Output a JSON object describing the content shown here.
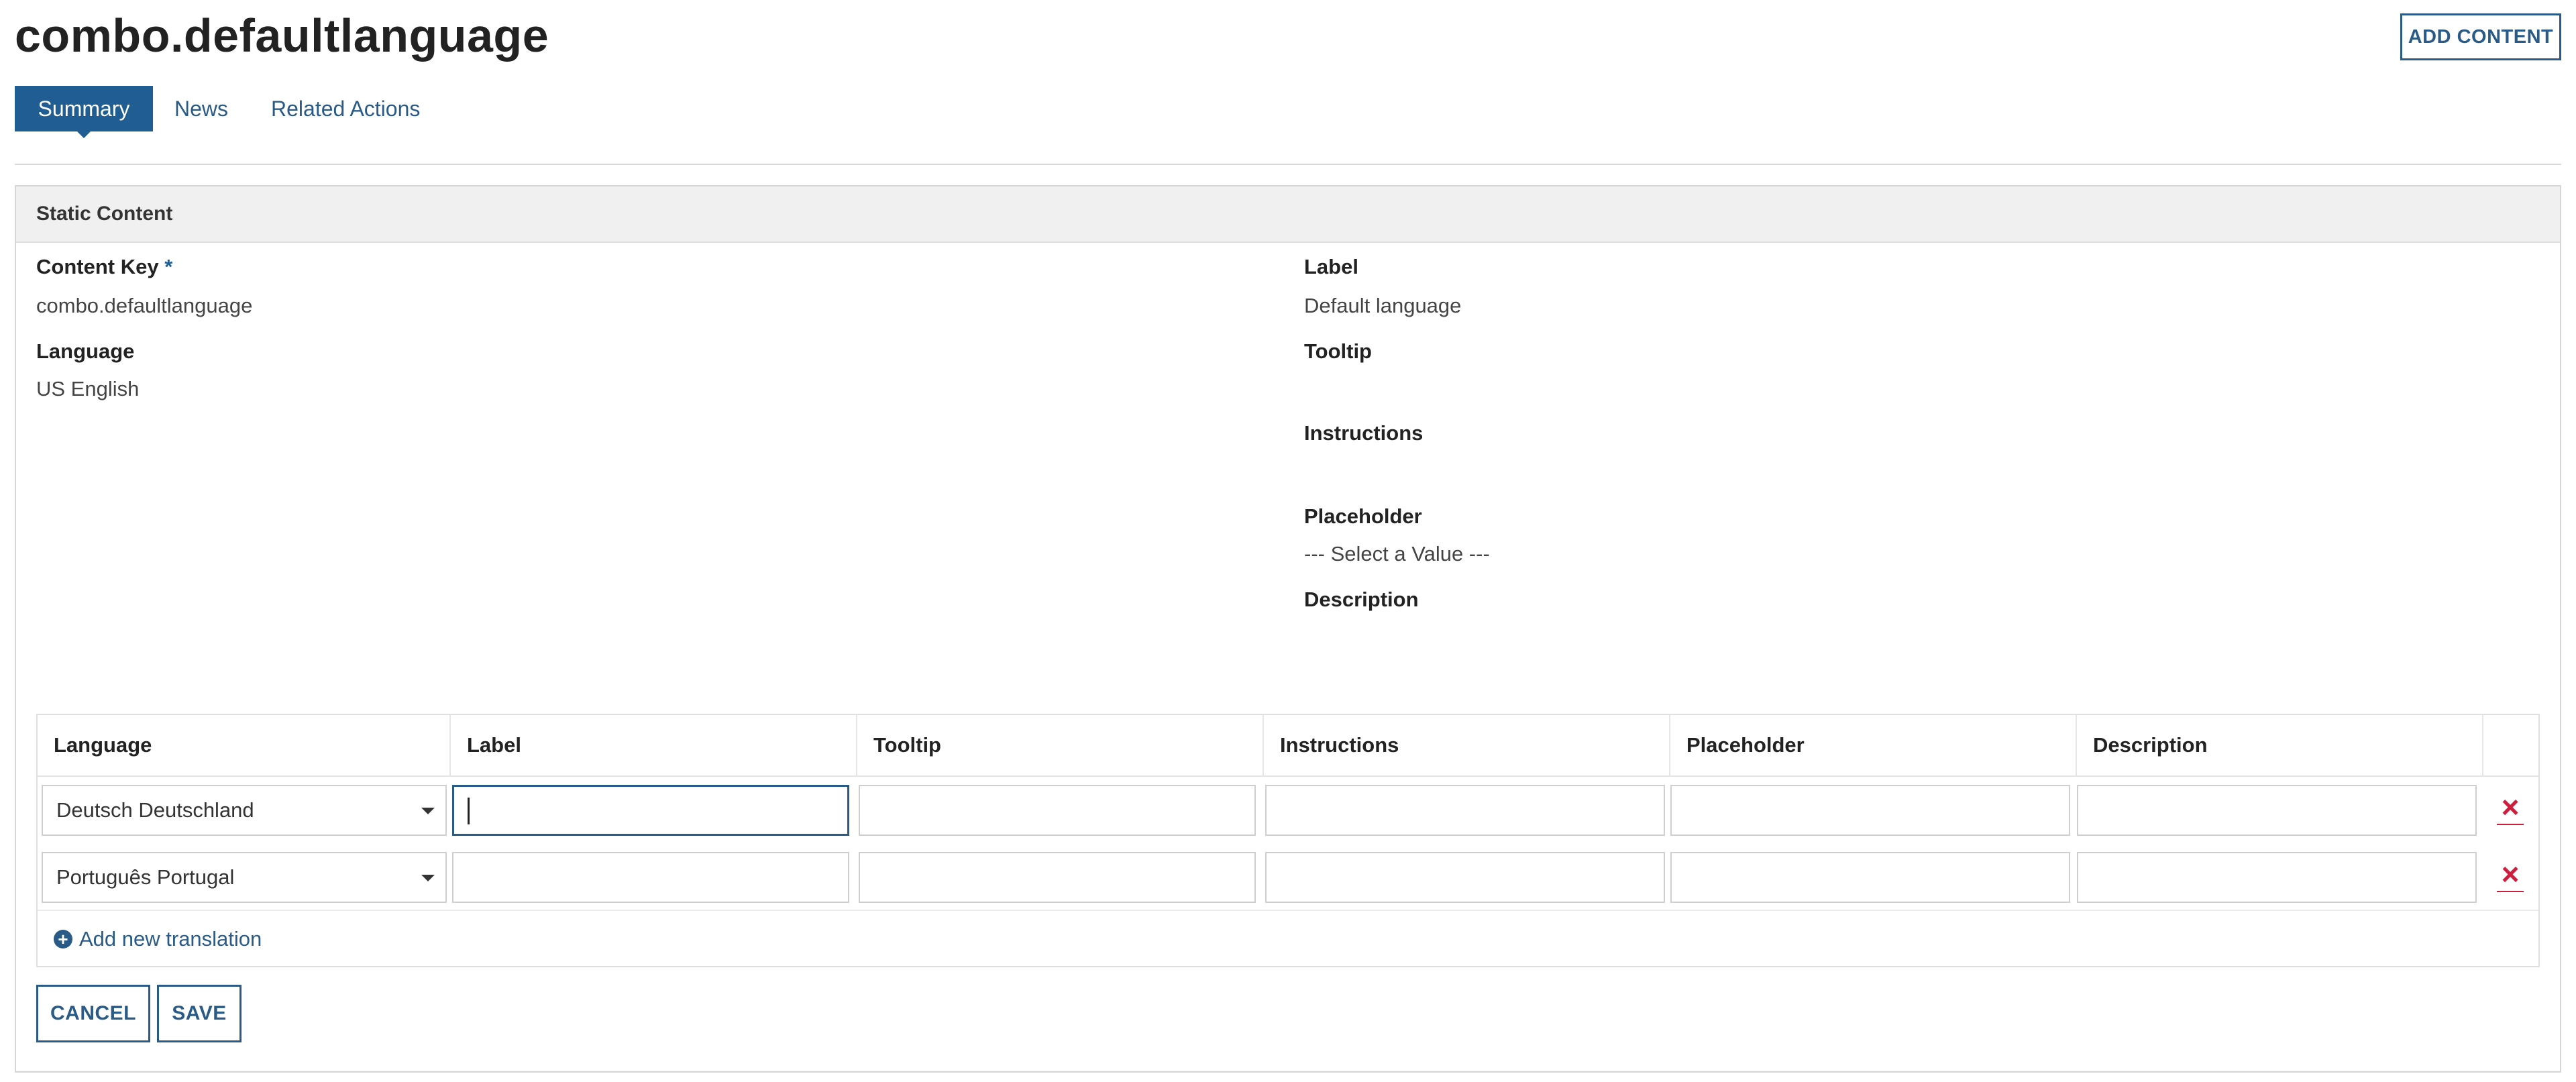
{
  "page": {
    "title": "combo.defaultlanguage",
    "add_content_label": "ADD CONTENT"
  },
  "tabs": [
    {
      "label": "Summary",
      "active": true
    },
    {
      "label": "News",
      "active": false
    },
    {
      "label": "Related Actions",
      "active": false
    }
  ],
  "panel": {
    "title": "Static Content",
    "content_key": {
      "label": "Content Key",
      "required_mark": "*",
      "value": "combo.defaultlanguage"
    },
    "language": {
      "label": "Language",
      "value": "US English"
    },
    "label": {
      "label": "Label",
      "value": "Default language"
    },
    "tooltip": {
      "label": "Tooltip",
      "value": ""
    },
    "instructions": {
      "label": "Instructions",
      "value": ""
    },
    "placeholder": {
      "label": "Placeholder",
      "value": "--- Select a Value ---"
    },
    "description": {
      "label": "Description",
      "value": ""
    }
  },
  "translations": {
    "columns": [
      "Language",
      "Label",
      "Tooltip",
      "Instructions",
      "Placeholder",
      "Description"
    ],
    "rows": [
      {
        "language": "Deutsch Deutschland",
        "label": "",
        "tooltip": "",
        "instructions": "",
        "placeholder": "",
        "description": ""
      },
      {
        "language": "Português Portugal",
        "label": "",
        "tooltip": "",
        "instructions": "",
        "placeholder": "",
        "description": ""
      }
    ],
    "add_label": "Add new translation"
  },
  "actions": {
    "cancel_label": "CANCEL",
    "save_label": "SAVE"
  },
  "colors": {
    "accent": "#2a5a86",
    "tab_active": "#1f5d93",
    "delete": "#cc1f3e"
  }
}
